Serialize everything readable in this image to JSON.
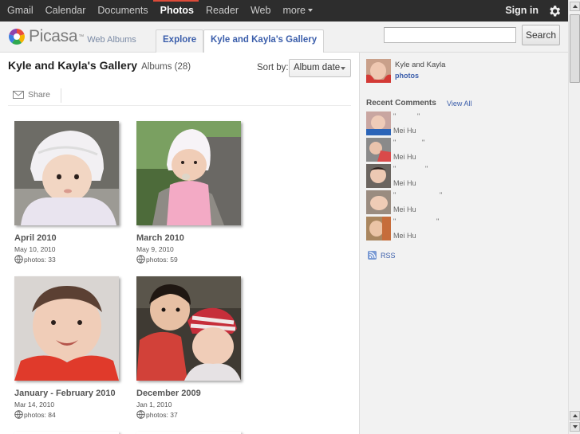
{
  "gbar": {
    "links": [
      {
        "label": "Gmail",
        "active": false
      },
      {
        "label": "Calendar",
        "active": false
      },
      {
        "label": "Documents",
        "active": false
      },
      {
        "label": "Photos",
        "active": true
      },
      {
        "label": "Reader",
        "active": false
      },
      {
        "label": "Web",
        "active": false
      }
    ],
    "more_label": "more",
    "signin_label": "Sign in",
    "settings_icon": "gear-icon"
  },
  "header": {
    "logo_text": "Picasa",
    "logo_tm": "™",
    "logo_sub": "Web Albums",
    "tabs": [
      {
        "label": "Explore"
      },
      {
        "label": "Kyle and Kayla's Gallery"
      }
    ],
    "search_value": "",
    "search_button": "Search"
  },
  "main": {
    "title": "Kyle and Kayla's Gallery",
    "album_count": "Albums (28)",
    "sort_label": "Sort by:",
    "sort_value": "Album date",
    "share_label": "Share",
    "albums": [
      {
        "title": "April 2010",
        "date": "May 10, 2010",
        "photos": "photos: 33"
      },
      {
        "title": "March 2010",
        "date": "May 9, 2010",
        "photos": "photos: 59"
      },
      {
        "title": "January - February 2010",
        "date": "Mar 14, 2010",
        "photos": "photos: 84"
      },
      {
        "title": "December 2009",
        "date": "Jan 1, 2010",
        "photos": "photos: 37"
      }
    ]
  },
  "sidebar": {
    "owner_name": "Kyle and Kayla",
    "owner_photos": "photos",
    "recent_comments_title": "Recent Comments",
    "view_all": "View All",
    "comments": [
      {
        "open_quote": "\"",
        "close_quote": "\"",
        "author": "Mei Hu"
      },
      {
        "open_quote": "\"",
        "close_quote": "\"",
        "author": "Mei Hu"
      },
      {
        "open_quote": "\"",
        "close_quote": "\"",
        "author": "Mei Hu"
      },
      {
        "open_quote": "\"",
        "close_quote": "\"",
        "author": "Mei Hu"
      },
      {
        "open_quote": "\"",
        "close_quote": "\"",
        "author": "Mei Hu"
      }
    ],
    "rss_label": "RSS"
  },
  "colors": {
    "link": "#3b5eab",
    "gbar_bg": "#2d2d2d",
    "gbar_active_accent": "#dd4b39"
  }
}
